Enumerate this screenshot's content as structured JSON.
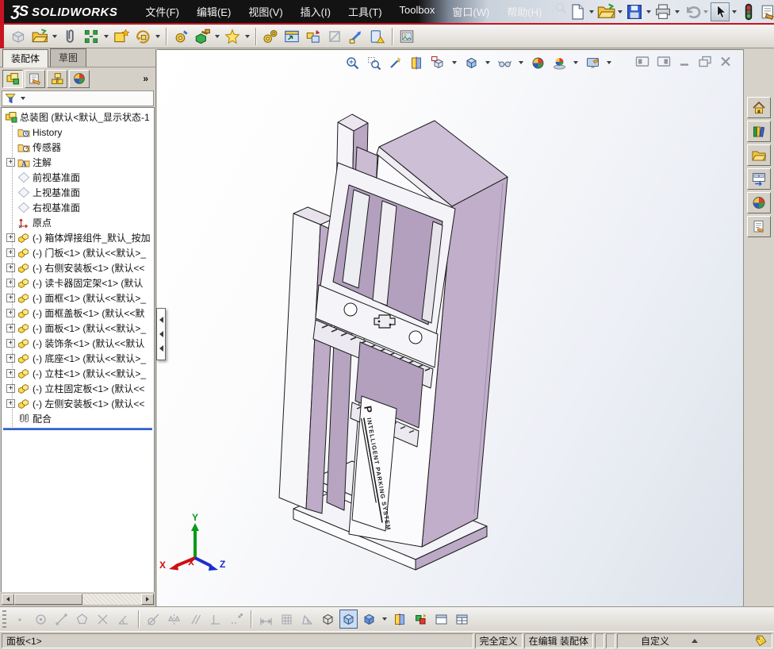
{
  "titlebar": {
    "logo_mark": "ƷS",
    "brand": "SOLIDWORKS",
    "menus": [
      "文件(F)",
      "编辑(E)",
      "视图(V)",
      "插入(I)",
      "工具(T)",
      "Toolbox",
      "窗口(W)",
      "帮助(H)"
    ],
    "quick_icons": [
      "new-document",
      "open",
      "save",
      "print",
      "undo",
      "select-arrow",
      "rebuild-traffic-light",
      "file-properties",
      "help"
    ],
    "window_controls": [
      "minimize",
      "restore",
      "close"
    ]
  },
  "assembly_toolbar": {
    "icons": [
      "insert-component",
      "open-part",
      "attachments",
      "mate",
      "smart-component",
      "rotate-component",
      "component-preview",
      "assembly-features",
      "reference-geometry",
      "motion-study",
      "exploded-view",
      "interference-detection",
      "hidden-components",
      "belt-chain",
      "simulation-setup",
      "photo-image"
    ]
  },
  "left_panel": {
    "tabs": [
      {
        "label": "装配体",
        "active": true
      },
      {
        "label": "草图",
        "active": false
      }
    ],
    "manager_tabs": [
      "feature-manager",
      "property-manager",
      "configuration-manager",
      "display-manager"
    ],
    "overflow_label": "»",
    "tree": {
      "expander_glyph": "+",
      "items": [
        {
          "label": "总装图 (默认<默认_显示状态-1",
          "icon": "asm",
          "level": 0,
          "exp": false,
          "root": true
        },
        {
          "label": "History",
          "icon": "history",
          "level": 1,
          "exp": false
        },
        {
          "label": "传感器",
          "icon": "sensors",
          "level": 1,
          "exp": false
        },
        {
          "label": "注解",
          "icon": "annotations",
          "level": 1,
          "exp": true
        },
        {
          "label": "前视基准面",
          "icon": "plane",
          "level": 1,
          "exp": false
        },
        {
          "label": "上视基准面",
          "icon": "plane",
          "level": 1,
          "exp": false
        },
        {
          "label": "右视基准面",
          "icon": "plane",
          "level": 1,
          "exp": false
        },
        {
          "label": "原点",
          "icon": "origin",
          "level": 1,
          "exp": false
        },
        {
          "label": "(-) 箱体焊接组件_默认_按加",
          "icon": "part",
          "level": 1,
          "exp": true
        },
        {
          "label": "(-) 门板<1> (默认<<默认>_",
          "icon": "part",
          "level": 1,
          "exp": true
        },
        {
          "label": "(-) 右侧安装板<1> (默认<<",
          "icon": "part",
          "level": 1,
          "exp": true
        },
        {
          "label": "(-) 读卡器固定架<1> (默认",
          "icon": "part",
          "level": 1,
          "exp": true
        },
        {
          "label": "(-) 面框<1> (默认<<默认>_",
          "icon": "part",
          "level": 1,
          "exp": true
        },
        {
          "label": "(-) 面框盖板<1> (默认<<默",
          "icon": "part",
          "level": 1,
          "exp": true
        },
        {
          "label": "(-) 面板<1> (默认<<默认>_",
          "icon": "part",
          "level": 1,
          "exp": true
        },
        {
          "label": "(-) 装饰条<1> (默认<<默认",
          "icon": "part",
          "level": 1,
          "exp": true
        },
        {
          "label": "(-) 底座<1> (默认<<默认>_",
          "icon": "part",
          "level": 1,
          "exp": true
        },
        {
          "label": "(-) 立柱<1> (默认<<默认>_",
          "icon": "part",
          "level": 1,
          "exp": true
        },
        {
          "label": "(-) 立柱固定板<1> (默认<<",
          "icon": "part",
          "level": 1,
          "exp": true
        },
        {
          "label": "(-) 左侧安装板<1> (默认<<",
          "icon": "part",
          "level": 1,
          "exp": true
        },
        {
          "label": "配合",
          "icon": "mates",
          "level": 1,
          "exp": false
        }
      ]
    }
  },
  "viewport": {
    "hud_icons": [
      "zoom-to-fit",
      "zoom-to-area",
      "previous-view",
      "section-view",
      "view-orientation",
      "display-style",
      "hide-show-items",
      "edit-appearance",
      "apply-scene",
      "view-settings"
    ],
    "doc_window_controls": [
      "pane-left",
      "pane-right",
      "minimize",
      "restore",
      "close"
    ],
    "model": {
      "brand_mark": "P",
      "side_text": "INTELLIGENT PARKING SYSTEM"
    },
    "triad": {
      "x": "X",
      "y": "Y",
      "z": "Z"
    },
    "colors": {
      "side_lavender": "#c0aeca",
      "opening_lavender": "#b2a0be",
      "front_white": "#fbfbfd"
    }
  },
  "task_pane": {
    "icons": [
      "home",
      "design-library",
      "file-explorer",
      "view-palette",
      "appearances",
      "custom-properties"
    ]
  },
  "bottom_toolbar": {
    "icons": [
      "sketch-point",
      "sketch-circle",
      "sketch-line",
      "sketch-polygon",
      "sketch-cross",
      "sketch-angle",
      "relation-tangent",
      "relation-symmetric",
      "relation-parallel",
      "relation-perpendicular",
      "relation-fix",
      "smart-dimension",
      "grid-snap",
      "angle-snap",
      "display-wireframe",
      "display-shaded",
      "display-mode-menu",
      "section-view-toggle",
      "large-assembly-mode",
      "split-horizontal",
      "split-grid"
    ]
  },
  "statusbar": {
    "selection": "面板<1>",
    "definition_state": "完全定义",
    "edit_mode": "在编辑 装配体",
    "custom_label": "自定义"
  }
}
